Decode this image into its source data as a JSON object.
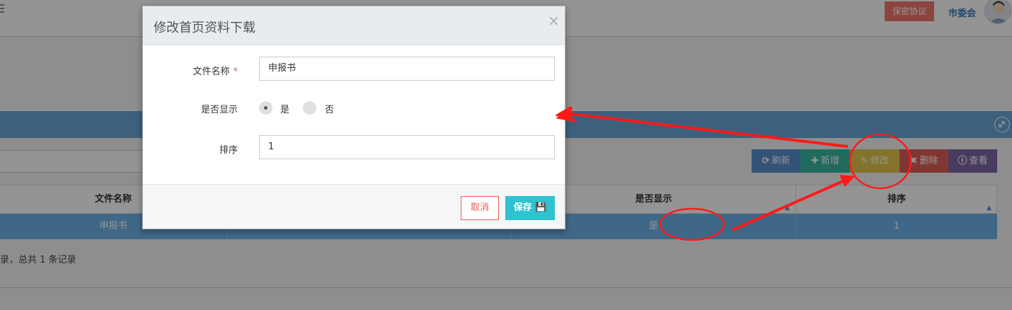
{
  "topbar": {
    "confidentiality_label": "保密协议",
    "user_name": "市委会"
  },
  "panel": {
    "toolbar": {
      "refresh": "刷新",
      "add": "新增",
      "edit": "修改",
      "delete": "删除",
      "view": "查看"
    },
    "table": {
      "columns": [
        "文件名称",
        "",
        "是否显示",
        "排序"
      ],
      "rows": [
        {
          "name": "申报书",
          "col2": "",
          "shown": "是",
          "order": "1"
        }
      ]
    },
    "pager_text": "录，总共 1 条记录"
  },
  "modal": {
    "title": "修改首页资料下载",
    "close": "×",
    "fields": {
      "name_label": "文件名称",
      "required_mark": "*",
      "name_value": "申报书",
      "show_label": "是否显示",
      "show_yes": "是",
      "show_no": "否",
      "order_label": "排序",
      "order_value": "1"
    },
    "cancel": "取消",
    "save": "保存"
  },
  "colors": {
    "header_blue": "#6aa6d6",
    "row_selected": "#6db3ea",
    "save_teal": "#2fc2cf",
    "danger_red": "#e15d58",
    "annotation_red": "#ff1a1a"
  },
  "icons": [
    "menu-icon",
    "avatar-icon",
    "expand-icon",
    "refresh-icon",
    "plus-icon",
    "edit-icon",
    "delete-icon",
    "info-icon",
    "sort-icon",
    "close-icon",
    "save-icon"
  ]
}
